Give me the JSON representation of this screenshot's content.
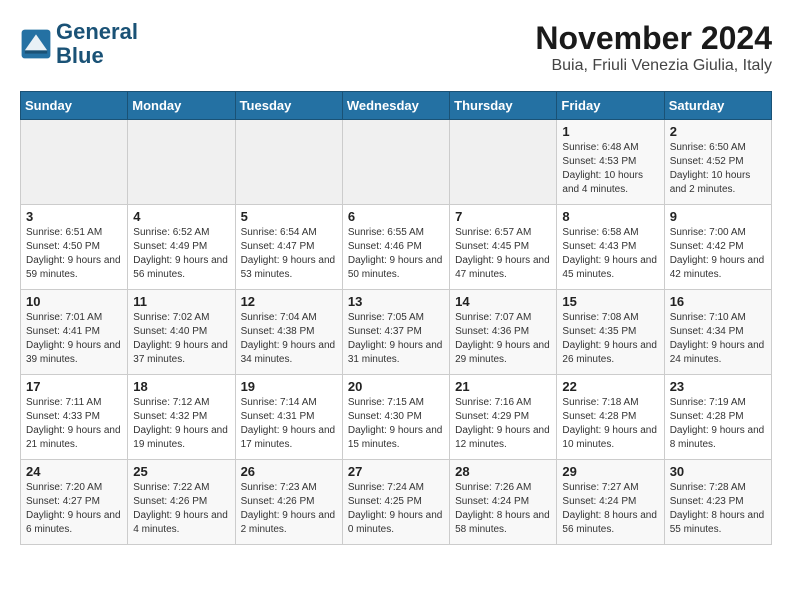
{
  "logo": {
    "line1": "General",
    "line2": "Blue"
  },
  "title": "November 2024",
  "subtitle": "Buia, Friuli Venezia Giulia, Italy",
  "headers": [
    "Sunday",
    "Monday",
    "Tuesday",
    "Wednesday",
    "Thursday",
    "Friday",
    "Saturday"
  ],
  "rows": [
    [
      {
        "day": "",
        "info": ""
      },
      {
        "day": "",
        "info": ""
      },
      {
        "day": "",
        "info": ""
      },
      {
        "day": "",
        "info": ""
      },
      {
        "day": "",
        "info": ""
      },
      {
        "day": "1",
        "info": "Sunrise: 6:48 AM\nSunset: 4:53 PM\nDaylight: 10 hours and 4 minutes."
      },
      {
        "day": "2",
        "info": "Sunrise: 6:50 AM\nSunset: 4:52 PM\nDaylight: 10 hours and 2 minutes."
      }
    ],
    [
      {
        "day": "3",
        "info": "Sunrise: 6:51 AM\nSunset: 4:50 PM\nDaylight: 9 hours and 59 minutes."
      },
      {
        "day": "4",
        "info": "Sunrise: 6:52 AM\nSunset: 4:49 PM\nDaylight: 9 hours and 56 minutes."
      },
      {
        "day": "5",
        "info": "Sunrise: 6:54 AM\nSunset: 4:47 PM\nDaylight: 9 hours and 53 minutes."
      },
      {
        "day": "6",
        "info": "Sunrise: 6:55 AM\nSunset: 4:46 PM\nDaylight: 9 hours and 50 minutes."
      },
      {
        "day": "7",
        "info": "Sunrise: 6:57 AM\nSunset: 4:45 PM\nDaylight: 9 hours and 47 minutes."
      },
      {
        "day": "8",
        "info": "Sunrise: 6:58 AM\nSunset: 4:43 PM\nDaylight: 9 hours and 45 minutes."
      },
      {
        "day": "9",
        "info": "Sunrise: 7:00 AM\nSunset: 4:42 PM\nDaylight: 9 hours and 42 minutes."
      }
    ],
    [
      {
        "day": "10",
        "info": "Sunrise: 7:01 AM\nSunset: 4:41 PM\nDaylight: 9 hours and 39 minutes."
      },
      {
        "day": "11",
        "info": "Sunrise: 7:02 AM\nSunset: 4:40 PM\nDaylight: 9 hours and 37 minutes."
      },
      {
        "day": "12",
        "info": "Sunrise: 7:04 AM\nSunset: 4:38 PM\nDaylight: 9 hours and 34 minutes."
      },
      {
        "day": "13",
        "info": "Sunrise: 7:05 AM\nSunset: 4:37 PM\nDaylight: 9 hours and 31 minutes."
      },
      {
        "day": "14",
        "info": "Sunrise: 7:07 AM\nSunset: 4:36 PM\nDaylight: 9 hours and 29 minutes."
      },
      {
        "day": "15",
        "info": "Sunrise: 7:08 AM\nSunset: 4:35 PM\nDaylight: 9 hours and 26 minutes."
      },
      {
        "day": "16",
        "info": "Sunrise: 7:10 AM\nSunset: 4:34 PM\nDaylight: 9 hours and 24 minutes."
      }
    ],
    [
      {
        "day": "17",
        "info": "Sunrise: 7:11 AM\nSunset: 4:33 PM\nDaylight: 9 hours and 21 minutes."
      },
      {
        "day": "18",
        "info": "Sunrise: 7:12 AM\nSunset: 4:32 PM\nDaylight: 9 hours and 19 minutes."
      },
      {
        "day": "19",
        "info": "Sunrise: 7:14 AM\nSunset: 4:31 PM\nDaylight: 9 hours and 17 minutes."
      },
      {
        "day": "20",
        "info": "Sunrise: 7:15 AM\nSunset: 4:30 PM\nDaylight: 9 hours and 15 minutes."
      },
      {
        "day": "21",
        "info": "Sunrise: 7:16 AM\nSunset: 4:29 PM\nDaylight: 9 hours and 12 minutes."
      },
      {
        "day": "22",
        "info": "Sunrise: 7:18 AM\nSunset: 4:28 PM\nDaylight: 9 hours and 10 minutes."
      },
      {
        "day": "23",
        "info": "Sunrise: 7:19 AM\nSunset: 4:28 PM\nDaylight: 9 hours and 8 minutes."
      }
    ],
    [
      {
        "day": "24",
        "info": "Sunrise: 7:20 AM\nSunset: 4:27 PM\nDaylight: 9 hours and 6 minutes."
      },
      {
        "day": "25",
        "info": "Sunrise: 7:22 AM\nSunset: 4:26 PM\nDaylight: 9 hours and 4 minutes."
      },
      {
        "day": "26",
        "info": "Sunrise: 7:23 AM\nSunset: 4:26 PM\nDaylight: 9 hours and 2 minutes."
      },
      {
        "day": "27",
        "info": "Sunrise: 7:24 AM\nSunset: 4:25 PM\nDaylight: 9 hours and 0 minutes."
      },
      {
        "day": "28",
        "info": "Sunrise: 7:26 AM\nSunset: 4:24 PM\nDaylight: 8 hours and 58 minutes."
      },
      {
        "day": "29",
        "info": "Sunrise: 7:27 AM\nSunset: 4:24 PM\nDaylight: 8 hours and 56 minutes."
      },
      {
        "day": "30",
        "info": "Sunrise: 7:28 AM\nSunset: 4:23 PM\nDaylight: 8 hours and 55 minutes."
      }
    ]
  ]
}
